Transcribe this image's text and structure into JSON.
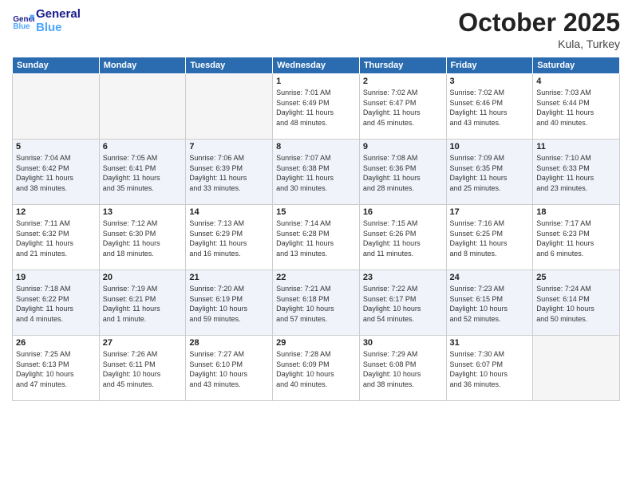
{
  "logo": {
    "line1": "General",
    "line2": "Blue"
  },
  "title": "October 2025",
  "location": "Kula, Turkey",
  "days_header": [
    "Sunday",
    "Monday",
    "Tuesday",
    "Wednesday",
    "Thursday",
    "Friday",
    "Saturday"
  ],
  "weeks": [
    [
      {
        "day": "",
        "info": ""
      },
      {
        "day": "",
        "info": ""
      },
      {
        "day": "",
        "info": ""
      },
      {
        "day": "1",
        "info": "Sunrise: 7:01 AM\nSunset: 6:49 PM\nDaylight: 11 hours\nand 48 minutes."
      },
      {
        "day": "2",
        "info": "Sunrise: 7:02 AM\nSunset: 6:47 PM\nDaylight: 11 hours\nand 45 minutes."
      },
      {
        "day": "3",
        "info": "Sunrise: 7:02 AM\nSunset: 6:46 PM\nDaylight: 11 hours\nand 43 minutes."
      },
      {
        "day": "4",
        "info": "Sunrise: 7:03 AM\nSunset: 6:44 PM\nDaylight: 11 hours\nand 40 minutes."
      }
    ],
    [
      {
        "day": "5",
        "info": "Sunrise: 7:04 AM\nSunset: 6:42 PM\nDaylight: 11 hours\nand 38 minutes."
      },
      {
        "day": "6",
        "info": "Sunrise: 7:05 AM\nSunset: 6:41 PM\nDaylight: 11 hours\nand 35 minutes."
      },
      {
        "day": "7",
        "info": "Sunrise: 7:06 AM\nSunset: 6:39 PM\nDaylight: 11 hours\nand 33 minutes."
      },
      {
        "day": "8",
        "info": "Sunrise: 7:07 AM\nSunset: 6:38 PM\nDaylight: 11 hours\nand 30 minutes."
      },
      {
        "day": "9",
        "info": "Sunrise: 7:08 AM\nSunset: 6:36 PM\nDaylight: 11 hours\nand 28 minutes."
      },
      {
        "day": "10",
        "info": "Sunrise: 7:09 AM\nSunset: 6:35 PM\nDaylight: 11 hours\nand 25 minutes."
      },
      {
        "day": "11",
        "info": "Sunrise: 7:10 AM\nSunset: 6:33 PM\nDaylight: 11 hours\nand 23 minutes."
      }
    ],
    [
      {
        "day": "12",
        "info": "Sunrise: 7:11 AM\nSunset: 6:32 PM\nDaylight: 11 hours\nand 21 minutes."
      },
      {
        "day": "13",
        "info": "Sunrise: 7:12 AM\nSunset: 6:30 PM\nDaylight: 11 hours\nand 18 minutes."
      },
      {
        "day": "14",
        "info": "Sunrise: 7:13 AM\nSunset: 6:29 PM\nDaylight: 11 hours\nand 16 minutes."
      },
      {
        "day": "15",
        "info": "Sunrise: 7:14 AM\nSunset: 6:28 PM\nDaylight: 11 hours\nand 13 minutes."
      },
      {
        "day": "16",
        "info": "Sunrise: 7:15 AM\nSunset: 6:26 PM\nDaylight: 11 hours\nand 11 minutes."
      },
      {
        "day": "17",
        "info": "Sunrise: 7:16 AM\nSunset: 6:25 PM\nDaylight: 11 hours\nand 8 minutes."
      },
      {
        "day": "18",
        "info": "Sunrise: 7:17 AM\nSunset: 6:23 PM\nDaylight: 11 hours\nand 6 minutes."
      }
    ],
    [
      {
        "day": "19",
        "info": "Sunrise: 7:18 AM\nSunset: 6:22 PM\nDaylight: 11 hours\nand 4 minutes."
      },
      {
        "day": "20",
        "info": "Sunrise: 7:19 AM\nSunset: 6:21 PM\nDaylight: 11 hours\nand 1 minute."
      },
      {
        "day": "21",
        "info": "Sunrise: 7:20 AM\nSunset: 6:19 PM\nDaylight: 10 hours\nand 59 minutes."
      },
      {
        "day": "22",
        "info": "Sunrise: 7:21 AM\nSunset: 6:18 PM\nDaylight: 10 hours\nand 57 minutes."
      },
      {
        "day": "23",
        "info": "Sunrise: 7:22 AM\nSunset: 6:17 PM\nDaylight: 10 hours\nand 54 minutes."
      },
      {
        "day": "24",
        "info": "Sunrise: 7:23 AM\nSunset: 6:15 PM\nDaylight: 10 hours\nand 52 minutes."
      },
      {
        "day": "25",
        "info": "Sunrise: 7:24 AM\nSunset: 6:14 PM\nDaylight: 10 hours\nand 50 minutes."
      }
    ],
    [
      {
        "day": "26",
        "info": "Sunrise: 7:25 AM\nSunset: 6:13 PM\nDaylight: 10 hours\nand 47 minutes."
      },
      {
        "day": "27",
        "info": "Sunrise: 7:26 AM\nSunset: 6:11 PM\nDaylight: 10 hours\nand 45 minutes."
      },
      {
        "day": "28",
        "info": "Sunrise: 7:27 AM\nSunset: 6:10 PM\nDaylight: 10 hours\nand 43 minutes."
      },
      {
        "day": "29",
        "info": "Sunrise: 7:28 AM\nSunset: 6:09 PM\nDaylight: 10 hours\nand 40 minutes."
      },
      {
        "day": "30",
        "info": "Sunrise: 7:29 AM\nSunset: 6:08 PM\nDaylight: 10 hours\nand 38 minutes."
      },
      {
        "day": "31",
        "info": "Sunrise: 7:30 AM\nSunset: 6:07 PM\nDaylight: 10 hours\nand 36 minutes."
      },
      {
        "day": "",
        "info": ""
      }
    ]
  ]
}
